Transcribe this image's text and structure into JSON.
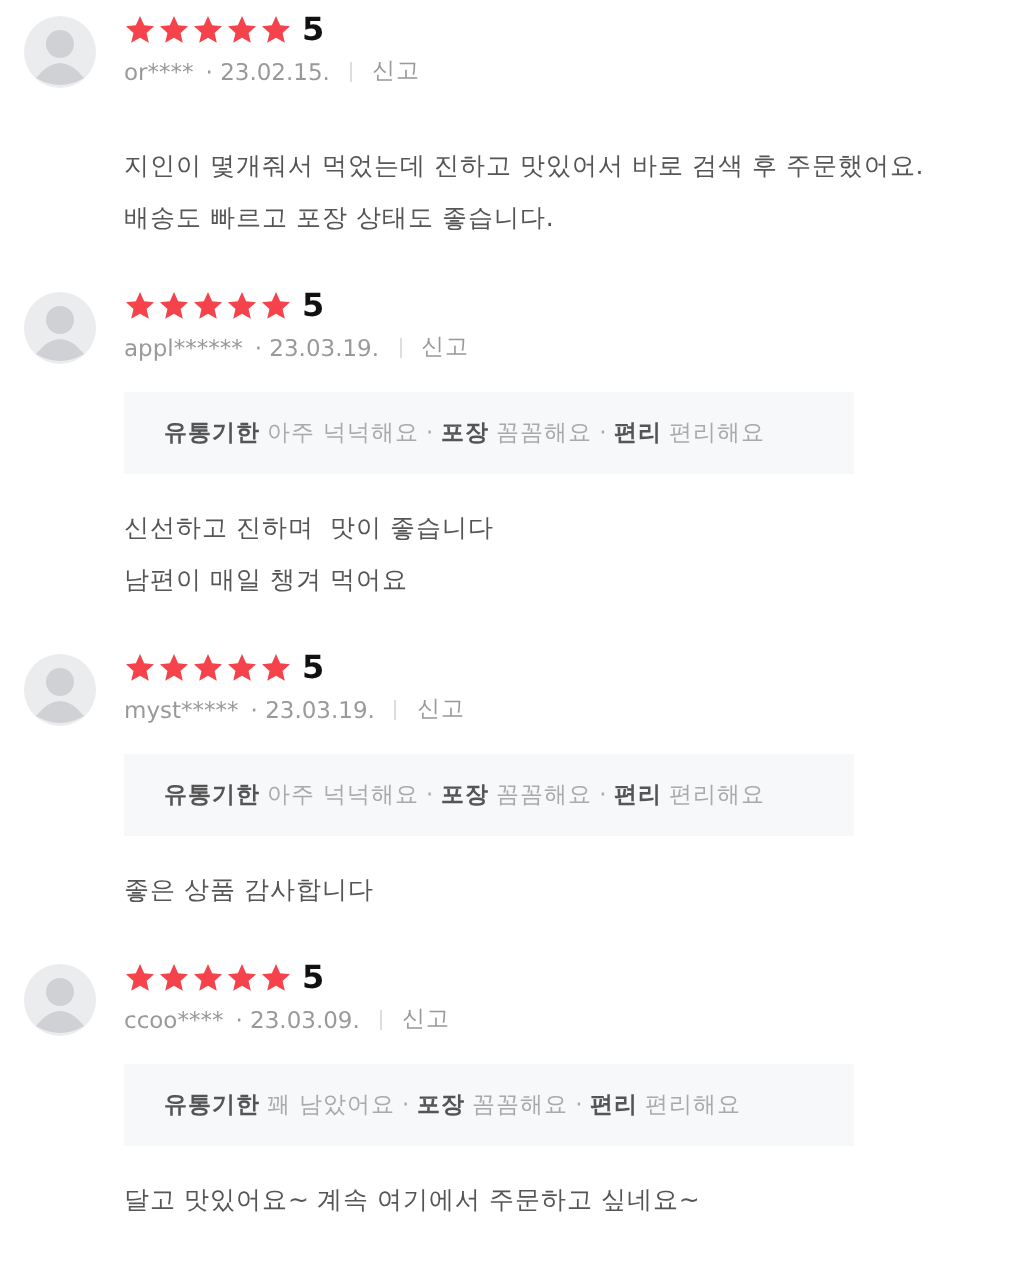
{
  "reviews": [
    {
      "stars": 5,
      "score": "5",
      "user": "or****",
      "date": "· 23.02.15.",
      "report": "신고",
      "body": [
        "지인이 몇개줘서 먹었는데 진하고 맛있어서 바로 검색 후 주문했어요.",
        "배송도 빠르고 포장 상태도 좋습니다."
      ]
    },
    {
      "stars": 5,
      "score": "5",
      "user": "appl******",
      "date": "· 23.03.19.",
      "report": "신고",
      "tags": "**유통기한** 아주 넉넉해요 · **포장** 꼼꼼해요 · **편리** 편리해요",
      "body": [
        "신선하고 진하며  맛이 좋습니다",
        "남편이 매일 챙겨 먹어요"
      ]
    },
    {
      "stars": 5,
      "score": "5",
      "user": "myst*****",
      "date": "· 23.03.19.",
      "report": "신고",
      "tags": "**유통기한** 아주 넉넉해요 · **포장** 꼼꼼해요 · **편리** 편리해요",
      "body": [
        "좋은 상품 감사합니다"
      ]
    },
    {
      "stars": 5,
      "score": "5",
      "user": "ccoo****",
      "date": "· 23.03.09.",
      "report": "신고",
      "tags": "**유통기한** 꽤 남았어요 · **포장** 꼼꼼해요 · **편리** 편리해요",
      "body": [
        "달고 맛있어요~ 계속 여기에서 주문하고 싶네요~"
      ]
    }
  ]
}
